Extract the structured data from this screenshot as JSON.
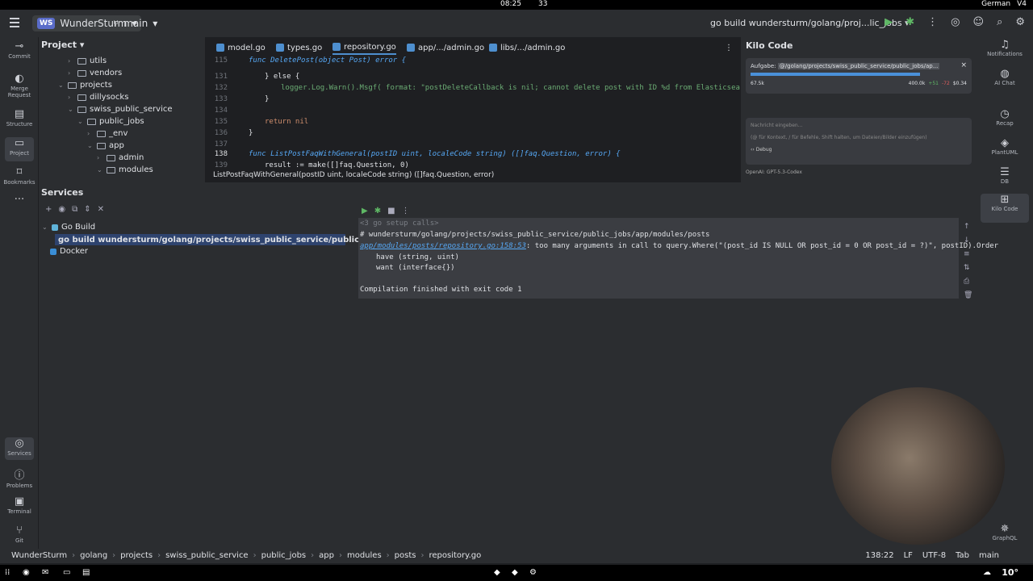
{
  "os": {
    "clock": "08:25",
    "network_count": "33",
    "language": "German",
    "volume": "V4"
  },
  "header": {
    "project_badge": "WS",
    "project_name": "WunderSturm",
    "branch": "main",
    "run_config": "go build wundersturm/golang/proj...lic_jobs"
  },
  "left_strip": [
    "Commit",
    "Merge Request",
    "Structure",
    "Project",
    "Bookmarks",
    "Services",
    "Problems",
    "Terminal",
    "Git"
  ],
  "right_strip": [
    "Notifications",
    "AI Chat",
    "Recap",
    "PlantUML",
    "DB",
    "Kilo Code",
    "GraphQL"
  ],
  "project_panel": {
    "title": "Project",
    "items": [
      {
        "label": "utils",
        "depth": 3
      },
      {
        "label": "vendors",
        "depth": 3
      },
      {
        "label": "projects",
        "depth": 2
      },
      {
        "label": "dillysocks",
        "depth": 3
      },
      {
        "label": "swiss_public_service",
        "depth": 3
      },
      {
        "label": "public_jobs",
        "depth": 4
      },
      {
        "label": "_env",
        "depth": 5
      },
      {
        "label": "app",
        "depth": 5
      },
      {
        "label": "admin",
        "depth": 6
      },
      {
        "label": "modules",
        "depth": 6
      }
    ]
  },
  "editor": {
    "tabs": [
      "model.go",
      "types.go",
      "repository.go",
      "app/.../admin.go",
      "libs/.../admin.go"
    ],
    "active_tab": "repository.go",
    "lines": [
      {
        "n": "115",
        "code": "func DeletePost(object Post) error {"
      },
      {
        "n": "131",
        "code": "} else {"
      },
      {
        "n": "132",
        "code": "logger.Log.Warn().Msgf( format: \"postDeleteCallback is nil; cannot delete post with ID %d from Elasticsearch via re"
      },
      {
        "n": "133",
        "code": "}"
      },
      {
        "n": "134",
        "code": ""
      },
      {
        "n": "135",
        "code": "return nil"
      },
      {
        "n": "136",
        "code": "}"
      },
      {
        "n": "137",
        "code": ""
      },
      {
        "n": "138",
        "code": "func ListPostFaqWithGeneral(postID uint, localeCode string) ([]faq.Question, error) {"
      },
      {
        "n": "139",
        "code": "result := make([]faq.Question, 0)"
      }
    ],
    "tooltip": "ListPostFaqWithGeneral(postID uint, localeCode string) ([]faq.Question, error)"
  },
  "kilo": {
    "title": "Kilo Code",
    "task_label": "Aufgabe:",
    "task_path": "@/golang/projects/swiss_public_service/public_jobs/ap...",
    "tokens": "67.5k",
    "context": "400.0k",
    "delta_up": "+51",
    "delta_down": "-72",
    "cost": "$0.34",
    "input_placeholder": "Nachricht eingeben...",
    "input_hint": "(@ für Kontext, / für Befehle, Shift halten, um Dateien/Bilder einzufügen)",
    "mode": "Debug",
    "model": "OpenAI: GPT-5.3-Codex"
  },
  "services": {
    "title": "Services",
    "tree": [
      {
        "label": "Go Build",
        "depth": 1
      },
      {
        "label": "go build wundersturm/golang/projects/swiss_public_service/public_jobs",
        "depth": 2
      },
      {
        "label": "Docker",
        "depth": 1
      }
    ],
    "console": {
      "header": "<3 go setup calls>",
      "pkg": "# wundersturm/golang/projects/swiss_public_service/public_jobs/app/modules/posts",
      "err_link": "app/modules/posts/repository.go:158:53",
      "err_msg": ": too many arguments in call to query.Where(\"(post_id IS NULL OR post_id = 0 OR post_id = ?)\", postID).Order",
      "have": "have (string, uint)",
      "want": "want (interface{})",
      "finish": "Compilation finished with exit code 1"
    }
  },
  "status": {
    "breadcrumb": [
      "WunderSturm",
      "golang",
      "projects",
      "swiss_public_service",
      "public_jobs",
      "app",
      "modules",
      "posts",
      "repository.go"
    ],
    "position": "138:22",
    "line_ending": "LF",
    "encoding": "UTF-8",
    "indent": "Tab",
    "branch": "main"
  },
  "taskbar": {
    "temperature": "10°"
  }
}
